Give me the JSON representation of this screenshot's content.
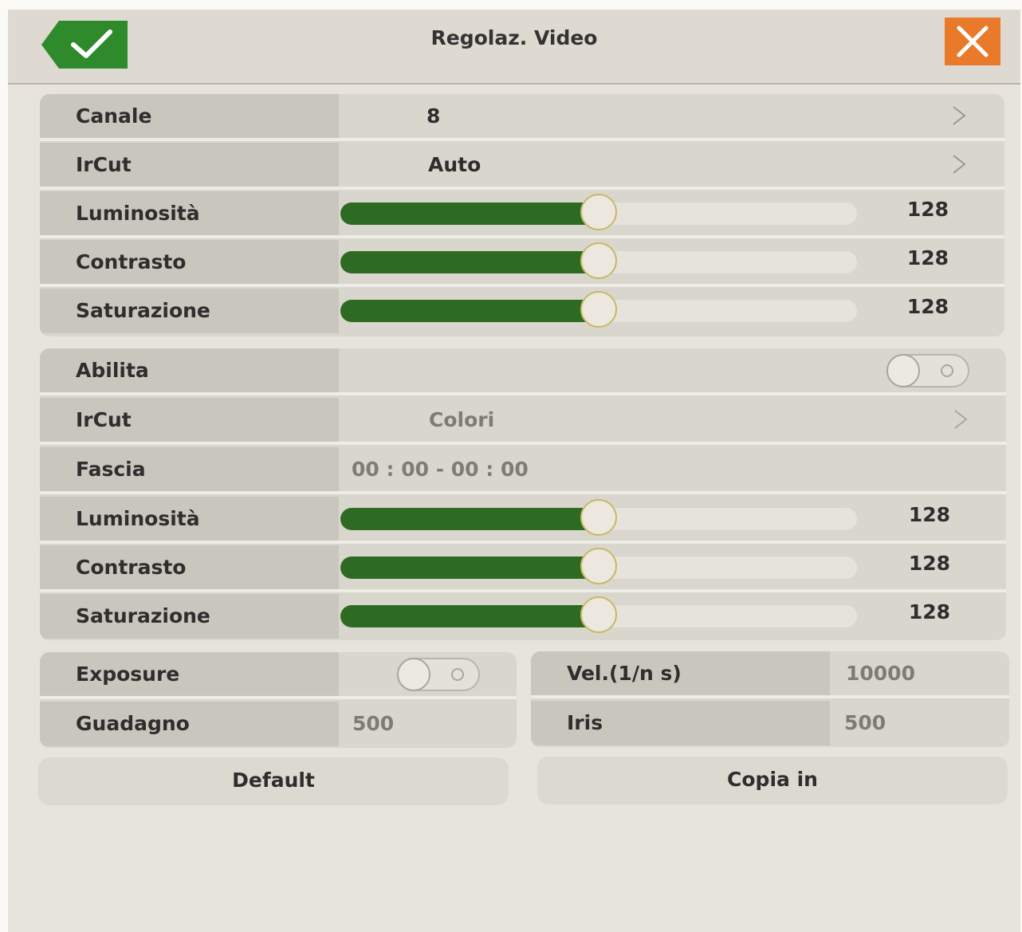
{
  "header": {
    "title": "Regolaz. Video"
  },
  "colors": {
    "accent_green": "#2e6b22",
    "close_orange": "#e97a2a",
    "ok_green": "#2f8a2c"
  },
  "icons": {
    "ok": "check-icon",
    "close": "close-icon",
    "next": "chevron-right-icon"
  },
  "section1": {
    "rows": [
      {
        "label": "Canale",
        "value": "8"
      },
      {
        "label": "IrCut",
        "value": "Auto"
      }
    ],
    "sliders": [
      {
        "label": "Luminosità",
        "value": "128",
        "level": 0.5
      },
      {
        "label": "Contrasto",
        "value": "128",
        "level": 0.5
      },
      {
        "label": "Saturazione",
        "value": "128",
        "level": 0.5
      }
    ]
  },
  "section2": {
    "enable_label": "Abilita",
    "enable_on": false,
    "ircut_label": "IrCut",
    "ircut_value": "Colori",
    "fascia_label": "Fascia",
    "fascia_value": "00 : 00 - 00 : 00",
    "sliders": [
      {
        "label": "Luminosità",
        "value": "128",
        "level": 0.5
      },
      {
        "label": "Contrasto",
        "value": "128",
        "level": 0.5
      },
      {
        "label": "Saturazione",
        "value": "128",
        "level": 0.5
      }
    ]
  },
  "section3": {
    "exposure_label": "Exposure",
    "exposure_on": false,
    "gain_label": "Guadagno",
    "gain_value": "500",
    "speed_label": "Vel.(1/n s)",
    "speed_value": "10000",
    "iris_label": "Iris",
    "iris_value": "500"
  },
  "buttons": {
    "default": "Default",
    "copy": "Copia in"
  }
}
